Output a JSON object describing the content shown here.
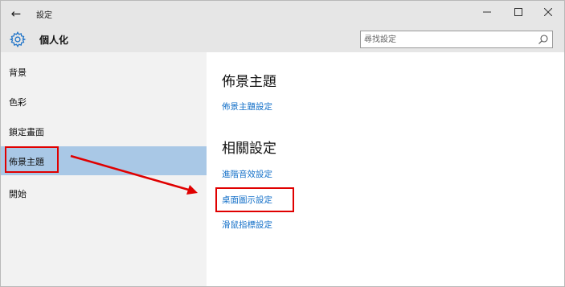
{
  "window": {
    "title": "設定",
    "back_glyph": "←",
    "minimize_glyph": "—",
    "maximize_glyph": "☐",
    "close_glyph": "✕"
  },
  "header": {
    "title": "個人化",
    "icon": "gear-icon",
    "search_placeholder": "尋找設定",
    "search_icon": "search-icon"
  },
  "sidebar": {
    "items": [
      {
        "label": "背景"
      },
      {
        "label": "色彩"
      },
      {
        "label": "鎖定畫面"
      },
      {
        "label": "佈景主題"
      },
      {
        "label": "開始"
      }
    ],
    "selected_index": 3
  },
  "main": {
    "section_title": "佈景主題",
    "theme_link": "佈景主題設定",
    "related_title": "相關設定",
    "related_links": [
      {
        "label": "進階音效設定"
      },
      {
        "label": "桌面圖示設定"
      },
      {
        "label": "滑鼠指標設定"
      }
    ]
  },
  "colors": {
    "accent": "#1470c8",
    "selection": "#a9c8e6",
    "annotation": "#e00000"
  }
}
